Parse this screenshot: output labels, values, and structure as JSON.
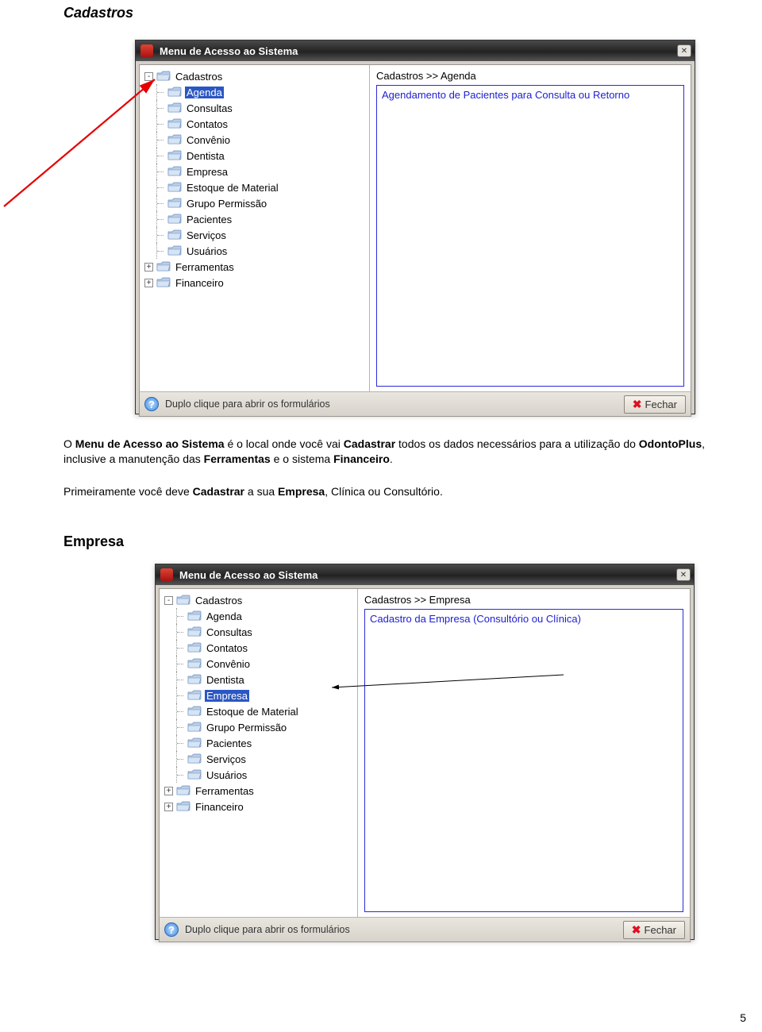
{
  "page_number": "5",
  "heading1": "Cadastros",
  "heading2": "Empresa",
  "para1_html": "O <b>Menu de Acesso ao Sistema</b> é o local onde você vai <b>Cadastrar</b> todos os dados necessários para a utilização do <b>OdontoPlus</b>, inclusive a manutenção das <b>Ferramentas</b> e o sistema <b>Financeiro</b>.",
  "para2_html": "Primeiramente você deve <b>Cadastrar</b> a sua <b>Empresa</b>, Clínica ou Consultório.",
  "window_title": "Menu de Acesso ao Sistema",
  "status_hint": "Duplo clique para abrir os formulários",
  "close_label": "Fechar",
  "win1": {
    "breadcrumb": "Cadastros >> Agenda",
    "description": "Agendamento de Pacientes para Consulta ou Retorno",
    "tree": [
      {
        "exp": "-",
        "label": "Cadastros",
        "folder": true,
        "level": 0
      },
      {
        "label": "Agenda",
        "folder": true,
        "level": 1,
        "selected": true
      },
      {
        "label": "Consultas",
        "folder": true,
        "level": 1
      },
      {
        "label": "Contatos",
        "folder": true,
        "level": 1
      },
      {
        "label": "Convênio",
        "folder": true,
        "level": 1
      },
      {
        "label": "Dentista",
        "folder": true,
        "level": 1
      },
      {
        "label": "Empresa",
        "folder": true,
        "level": 1
      },
      {
        "label": "Estoque de Material",
        "folder": true,
        "level": 1
      },
      {
        "label": "Grupo Permissão",
        "folder": true,
        "level": 1
      },
      {
        "label": "Pacientes",
        "folder": true,
        "level": 1
      },
      {
        "label": "Serviços",
        "folder": true,
        "level": 1
      },
      {
        "label": "Usuários",
        "folder": true,
        "level": 1
      },
      {
        "exp": "+",
        "label": "Ferramentas",
        "folder": true,
        "level": 0
      },
      {
        "exp": "+",
        "label": "Financeiro",
        "folder": true,
        "level": 0
      }
    ]
  },
  "win2": {
    "breadcrumb": "Cadastros >> Empresa",
    "description": "Cadastro da Empresa (Consultório ou Clínica)",
    "tree": [
      {
        "exp": "-",
        "label": "Cadastros",
        "folder": true,
        "level": 0
      },
      {
        "label": "Agenda",
        "folder": true,
        "level": 1
      },
      {
        "label": "Consultas",
        "folder": true,
        "level": 1
      },
      {
        "label": "Contatos",
        "folder": true,
        "level": 1
      },
      {
        "label": "Convênio",
        "folder": true,
        "level": 1
      },
      {
        "label": "Dentista",
        "folder": true,
        "level": 1
      },
      {
        "label": "Empresa",
        "folder": true,
        "level": 1,
        "selected": true
      },
      {
        "label": "Estoque de Material",
        "folder": true,
        "level": 1
      },
      {
        "label": "Grupo Permissão",
        "folder": true,
        "level": 1
      },
      {
        "label": "Pacientes",
        "folder": true,
        "level": 1
      },
      {
        "label": "Serviços",
        "folder": true,
        "level": 1
      },
      {
        "label": "Usuários",
        "folder": true,
        "level": 1
      },
      {
        "exp": "+",
        "label": "Ferramentas",
        "folder": true,
        "level": 0
      },
      {
        "exp": "+",
        "label": "Financeiro",
        "folder": true,
        "level": 0
      }
    ]
  }
}
